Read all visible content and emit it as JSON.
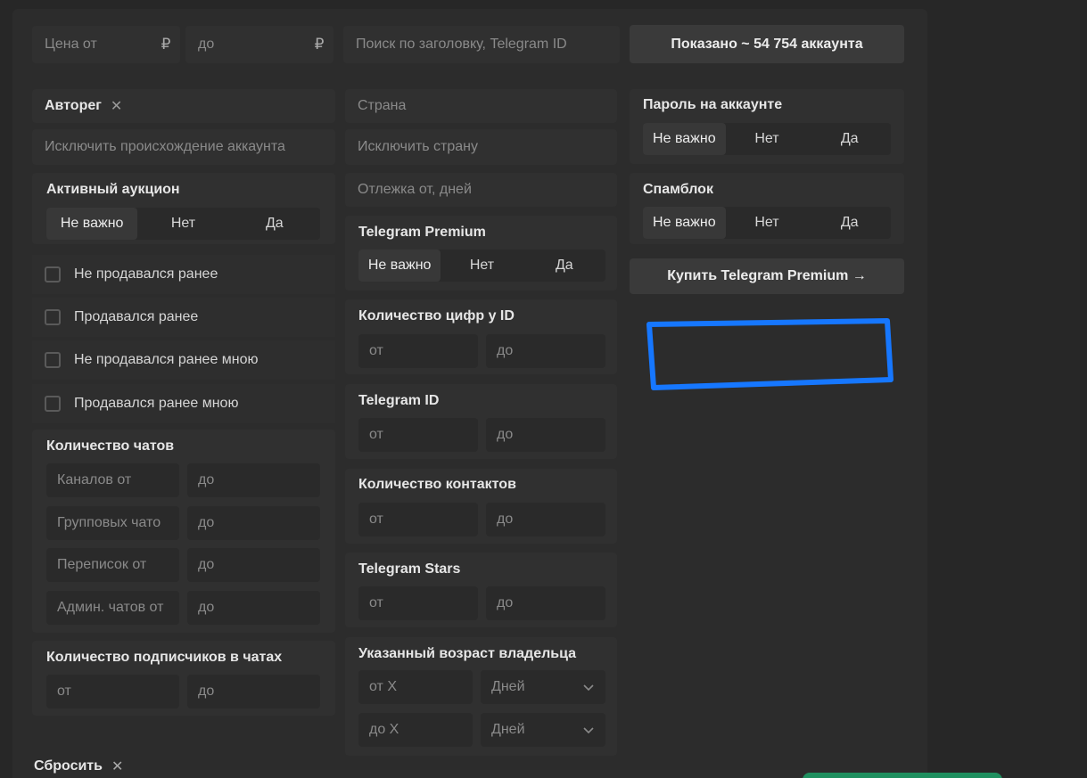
{
  "colors": {
    "highlight": "#1677ff",
    "panel": "#2c2c2c",
    "green": "#1f8f5f"
  },
  "price": {
    "from_placeholder": "Цена от",
    "to_placeholder": "до",
    "currency": "₽"
  },
  "search": {
    "placeholder": "Поиск по заголовку, Telegram ID"
  },
  "shown_button": "Показано ~ 54 754 аккаунта",
  "origin": {
    "chip": "Авторег",
    "exclude_placeholder": "Исключить происхождение аккаунта"
  },
  "country": {
    "placeholder": "Страна",
    "exclude_placeholder": "Исключить страну"
  },
  "rest": {
    "placeholder": "Отлежка от, дней"
  },
  "segments": [
    "Не важно",
    "Нет",
    "Да"
  ],
  "password": {
    "title": "Пароль на аккаунте"
  },
  "spamblock": {
    "title": "Спамблок"
  },
  "auction": {
    "title": "Активный аукцион"
  },
  "premium": {
    "title": "Telegram Premium"
  },
  "buy_premium": "Купить Telegram Premium →",
  "checkboxes": [
    "Не продавался ранее",
    "Продавался ранее",
    "Не продавался ранее мною",
    "Продавался ранее мною"
  ],
  "chats": {
    "title": "Количество чатов",
    "rows": [
      {
        "from": "Каналов от",
        "to": "до"
      },
      {
        "from": "Групповых чато",
        "to": "до"
      },
      {
        "from": "Переписок от",
        "to": "до"
      },
      {
        "from": "Админ. чатов от",
        "to": "до"
      }
    ]
  },
  "subscribers": {
    "title": "Количество подписчиков в чатах",
    "from": "от",
    "to": "до"
  },
  "digits": {
    "title": "Количество цифр у ID",
    "from": "от",
    "to": "до"
  },
  "tgid": {
    "title": "Telegram ID",
    "from": "от",
    "to": "до"
  },
  "contacts": {
    "title": "Количество контактов",
    "from": "от",
    "to": "до"
  },
  "stars": {
    "title": "Telegram Stars",
    "from": "от",
    "to": "до"
  },
  "age": {
    "title": "Указанный возраст владельца",
    "from": "от X",
    "to": "до X",
    "unit": "Дней"
  },
  "reset": "Сбросить"
}
